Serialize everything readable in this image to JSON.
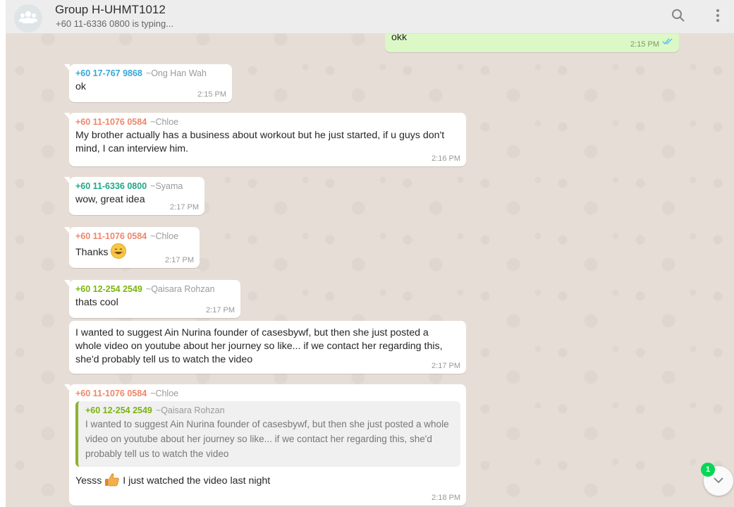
{
  "header": {
    "title": "Group H-UHMT1012",
    "subtitle": "+60 11-6336 0800 is typing...",
    "avatar_icon": "group-icon",
    "search_icon": "search-icon",
    "menu_icon": "menu-dots-icon"
  },
  "colors": {
    "outgoing_bubble": "#dcf8c6",
    "incoming_bubble": "#ffffff",
    "read_ticks": "#4fc3f7",
    "sender_blue": "#35a8d9",
    "sender_orange": "#f0866a",
    "sender_teal": "#1fa886",
    "sender_olive": "#7cb30f",
    "unread_badge": "#06d755"
  },
  "messages": [
    {
      "type": "out",
      "text": "okk",
      "time": "2:15 PM",
      "status_icon": "double-check-icon"
    },
    {
      "type": "in",
      "phone": "+60 17-767 9868",
      "name": "~Ong Han Wah",
      "text": "ok",
      "time": "2:15 PM"
    },
    {
      "type": "in",
      "phone": "+60 11-1076 0584",
      "name": "~Chloe",
      "text": "My brother actually has a business about workout but he just started, if u guys don't mind, I can interview him.",
      "time": "2:16 PM"
    },
    {
      "type": "in",
      "phone": "+60 11-6336 0800",
      "name": "~Syama",
      "text": "wow, great idea",
      "time": "2:17 PM"
    },
    {
      "type": "in",
      "phone": "+60 11-1076 0584",
      "name": "~Chloe",
      "text": "Thanks",
      "emoji": "smiling-face-emoji",
      "time": "2:17 PM"
    },
    {
      "type": "in",
      "phone": "+60 12-254 2549",
      "name": "~Qaisara Rohzan",
      "text": "thats cool",
      "time": "2:17 PM"
    },
    {
      "type": "in",
      "text": "I wanted to suggest Ain Nurina founder of casesbywf, but then she just posted a whole video on youtube about her journey so like... if we contact her regarding this, she'd probably tell us to watch the video",
      "time": "2:17 PM"
    },
    {
      "type": "in",
      "phone": "+60 11-1076 0584",
      "name": "~Chloe",
      "quote": {
        "phone": "+60 12-254 2549",
        "name": "~Qaisara Rohzan",
        "text": "I wanted to suggest Ain Nurina founder of casesbywf, but then she just posted a whole video on youtube about her journey so like... if we contact her regarding this, she'd probably tell us to watch the video"
      },
      "text_before": "Yesss",
      "emoji": "thumbs-up-emoji",
      "text_after": "I just watched the video last night",
      "time": "2:18 PM"
    }
  ],
  "scroll_button": {
    "unread_count": "1",
    "icon": "chevron-down-icon"
  }
}
